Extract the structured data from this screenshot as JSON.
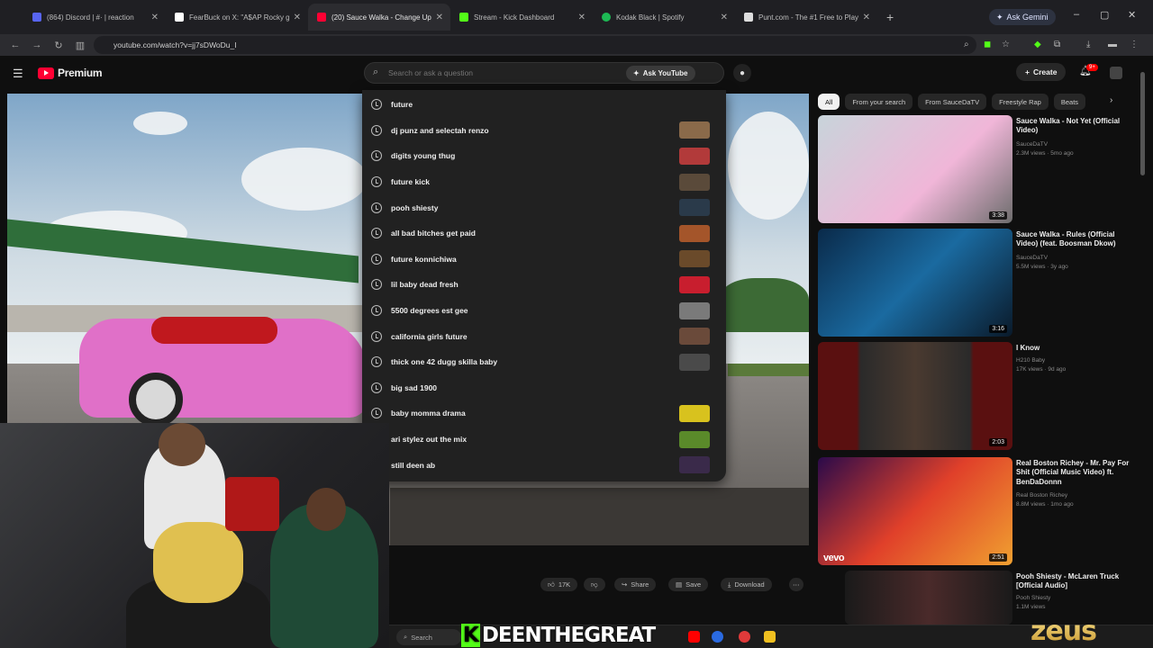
{
  "browser": {
    "tabs": [
      {
        "title": "(864) Discord | #· | reaction",
        "icon_color": "#5865F2"
      },
      {
        "title": "FearBuck on X: \"A$AP Rocky g",
        "icon_color": "#ffffff"
      },
      {
        "title": "(20) Sauce Walka - Change Up",
        "icon_color": "#ff0033"
      },
      {
        "title": "Stream - Kick Dashboard",
        "icon_color": "#53fc18"
      },
      {
        "title": "Kodak Black | Spotify",
        "icon_color": "#1DB954"
      },
      {
        "title": "Punt.com - The #1 Free to Play",
        "icon_color": "#dddddd"
      }
    ],
    "active_tab_index": 2,
    "new_tab": "+",
    "ask_gemini": "Ask Gemini",
    "url": "youtube.com/watch?v=jj7sDWoDu_I",
    "window_controls": [
      "–",
      "▢",
      "✕"
    ]
  },
  "youtube": {
    "logo_text": "Premium",
    "search_placeholder": "Search or ask a question",
    "ask_youtube": "Ask YouTube",
    "create": "Create",
    "notification_count": "9+",
    "suggestions": [
      {
        "text": "future",
        "thumb": ""
      },
      {
        "text": "dj punz and selectah renzo",
        "thumb": "#8a6a4a"
      },
      {
        "text": "digits young thug",
        "thumb": "#b23a3a"
      },
      {
        "text": "future kick",
        "thumb": "#5a4a3a"
      },
      {
        "text": "pooh shiesty",
        "thumb": "#2a3a4a"
      },
      {
        "text": "all bad bitches get paid",
        "thumb": "#a4552a"
      },
      {
        "text": "future konnichiwa",
        "thumb": "#6a4a2a"
      },
      {
        "text": "lil baby dead fresh",
        "thumb": "#c81e2e"
      },
      {
        "text": "5500 degrees est gee",
        "thumb": "#7a7a7a"
      },
      {
        "text": "california girls future",
        "thumb": "#6a4a3a"
      },
      {
        "text": "thick one 42 dugg skilla baby",
        "thumb": "#4a4a4a"
      },
      {
        "text": "big sad 1900",
        "thumb": ""
      },
      {
        "text": "baby momma drama",
        "thumb": "#d8c21e"
      },
      {
        "text": "ari stylez out the mix",
        "thumb": "#5a8a2a"
      },
      {
        "text": "still deen ab",
        "thumb": "#3a2a4a"
      }
    ],
    "actions": [
      {
        "label": "17K",
        "icon": "thumbs-up-icon"
      },
      {
        "label": "",
        "icon": "thumbs-down-icon"
      },
      {
        "label": "Share",
        "icon": "share-icon"
      },
      {
        "label": "Save",
        "icon": "save-icon"
      },
      {
        "label": "Download",
        "icon": "download-icon"
      }
    ],
    "chips": [
      "All",
      "From your search",
      "From SauceDaTV",
      "Freestyle Rap",
      "Beats"
    ],
    "recommendations": [
      {
        "title": "Sauce Walka - Not Yet (Official Video)",
        "channel": "SauceDaTV",
        "meta": "2.3M views · 5mo ago",
        "duration": "3:38"
      },
      {
        "title": "Sauce Walka - Rules (Official Video) (feat. Boosman Dkow)",
        "channel": "SauceDaTV",
        "meta": "5.5M views · 3y ago",
        "duration": "3:16"
      },
      {
        "title": "I Know",
        "channel": "H210 Baby",
        "meta": "17K views · 9d ago",
        "duration": "2:03"
      },
      {
        "title": "Real Boston Richey - Mr. Pay For Shit (Official Music Video) ft. BenDaDonnn",
        "channel": "Real Boston Richey",
        "meta": "8.8M views · 1mo ago",
        "duration": "2:51"
      },
      {
        "title": "Pooh Shiesty - McLaren Truck [Official Audio]",
        "channel": "Pooh Shiesty",
        "meta": "1.1M views",
        "duration": ""
      }
    ],
    "vevo": "vevo"
  },
  "taskbar": {
    "search": "Search"
  },
  "overlay": {
    "name": "DEENTHEGREAT",
    "brand": "zeus"
  }
}
